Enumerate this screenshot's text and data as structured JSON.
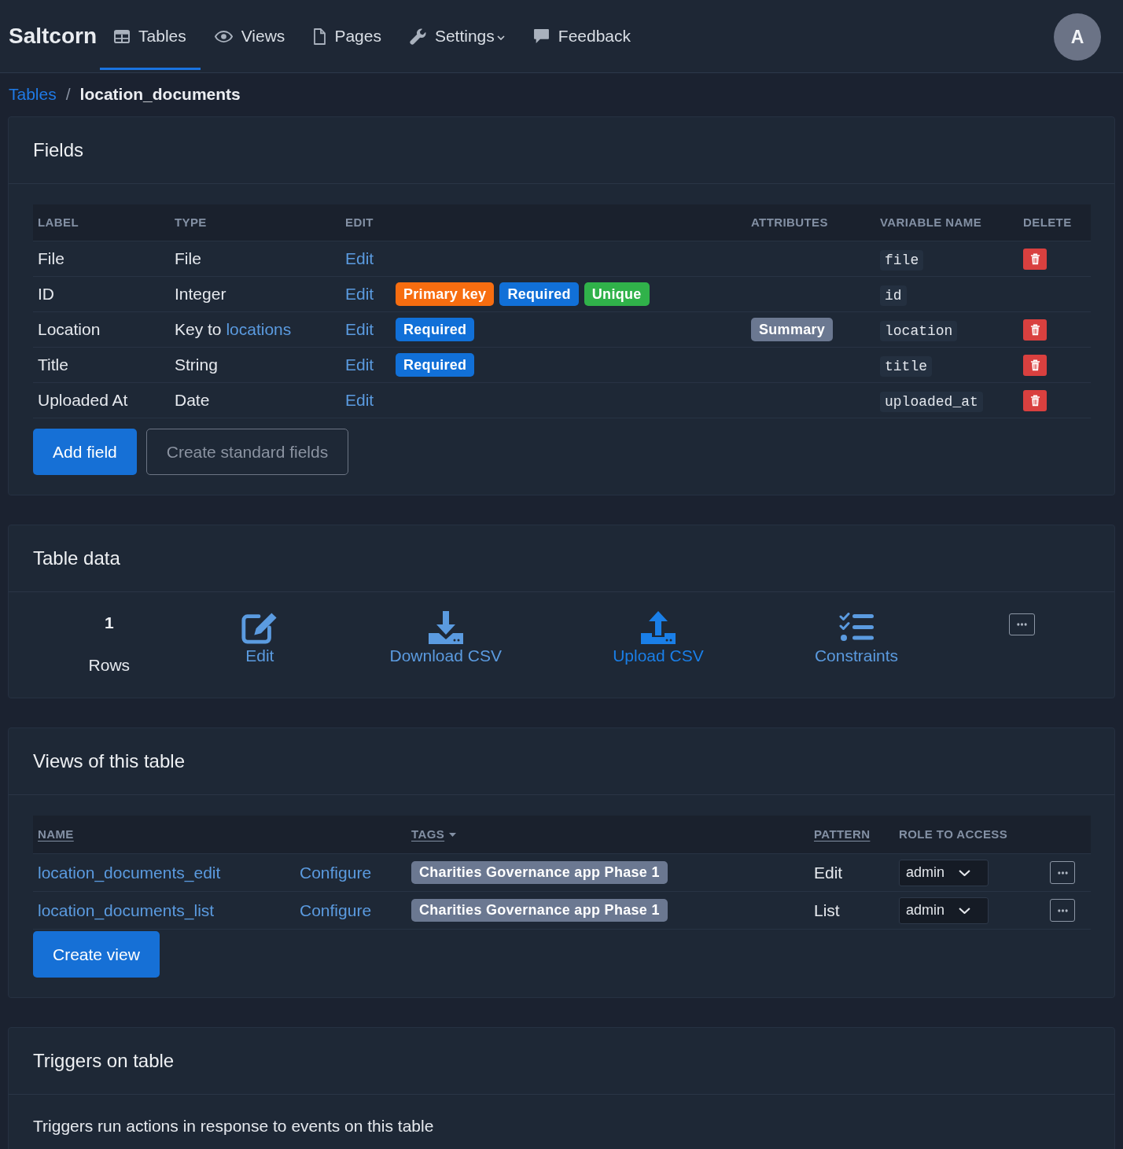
{
  "navbar": {
    "brand": "Saltcorn",
    "items": [
      {
        "label": "Tables",
        "selected": true,
        "dropdown": false
      },
      {
        "label": "Views",
        "selected": false,
        "dropdown": false
      },
      {
        "label": "Pages",
        "selected": false,
        "dropdown": false
      },
      {
        "label": "Settings",
        "selected": false,
        "dropdown": true
      },
      {
        "label": "Feedback",
        "selected": false,
        "dropdown": false
      }
    ],
    "avatar": "A"
  },
  "breadcrumb": {
    "items": [
      {
        "label": "Tables",
        "kind": "link"
      },
      {
        "label": "location_documents",
        "kind": "current"
      }
    ],
    "separator": "/"
  },
  "fields": {
    "title": "Fields",
    "table": {
      "columns": [
        "LABEL",
        "TYPE",
        "EDIT",
        "ATTRIBUTES",
        "VARIABLE NAME",
        "DELETE"
      ],
      "rows": [
        {
          "label": "File",
          "type": "File",
          "edit": "Edit",
          "variable_name": "file",
          "deletable": true
        },
        {
          "label": "ID",
          "type": "Integer",
          "edit": "Edit",
          "badges": [
            {
              "label": "Primary key",
              "color": "#f76d10"
            },
            {
              "label": "Required",
              "color": "#1170d8"
            },
            {
              "label": "Unique",
              "color": "#30b24a"
            }
          ],
          "variable_name": "id",
          "deletable": false
        },
        {
          "label": "Location",
          "type": "Key to",
          "type_link": "locations",
          "edit": "Edit",
          "badges": [
            {
              "label": "Required",
              "color": "#1170d8"
            }
          ],
          "attributes": [
            "Summary"
          ],
          "variable_name": "location",
          "deletable": true
        },
        {
          "label": "Title",
          "type": "String",
          "edit": "Edit",
          "badges": [
            {
              "label": "Required",
              "color": "#1170d8"
            }
          ],
          "variable_name": "title",
          "deletable": true
        },
        {
          "label": "Uploaded At",
          "type": "Date",
          "edit": "Edit",
          "variable_name": "uploaded_at",
          "deletable": true
        }
      ]
    },
    "buttons": [
      {
        "label": "Add field",
        "kind": "primary"
      },
      {
        "label": "Create standard fields",
        "kind": "outline"
      }
    ]
  },
  "table_data": {
    "title": "Table data",
    "row_count": "1",
    "row_count_label": "Rows",
    "actions": [
      {
        "label": "Edit",
        "hovered": false
      },
      {
        "label": "Download CSV",
        "hovered": false
      },
      {
        "label": "Upload CSV",
        "hovered": true
      },
      {
        "label": "Constraints",
        "hovered": false
      }
    ]
  },
  "views": {
    "title": "Views of this table",
    "table": {
      "columns": [
        {
          "label": "NAME",
          "sortable": true,
          "dropdown": false
        },
        {
          "label": "TAGS",
          "sortable": true,
          "dropdown": true
        },
        {
          "label": "PATTERN",
          "sortable": true,
          "dropdown": false
        },
        {
          "label": "ROLE TO ACCESS",
          "sortable": false,
          "dropdown": false
        }
      ],
      "rows": [
        {
          "name": "location_documents_edit",
          "configure": "Configure",
          "tags": [
            "Charities Governance app Phase 1"
          ],
          "pattern": "Edit",
          "role": "admin"
        },
        {
          "name": "location_documents_list",
          "configure": "Configure",
          "tags": [
            "Charities Governance app Phase 1"
          ],
          "pattern": "List",
          "role": "admin"
        }
      ]
    },
    "buttons": [
      {
        "label": "Create view",
        "kind": "primary"
      }
    ]
  },
  "triggers": {
    "title": "Triggers on table",
    "description": "Triggers run actions in response to events on this table"
  }
}
